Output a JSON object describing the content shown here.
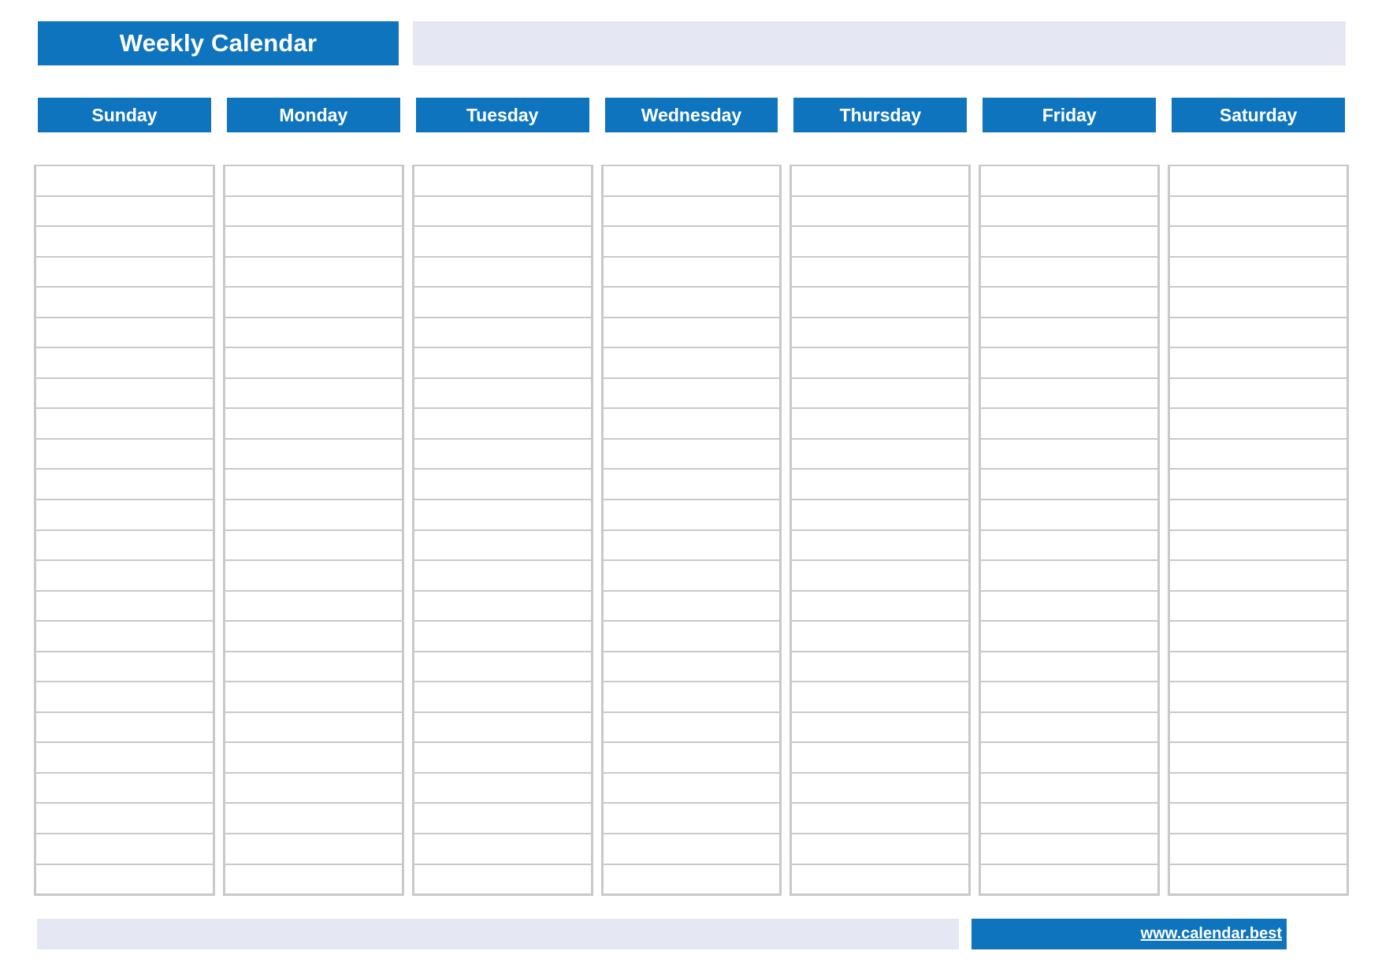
{
  "header": {
    "title": "Weekly Calendar"
  },
  "days": [
    {
      "label": "Sunday"
    },
    {
      "label": "Monday"
    },
    {
      "label": "Tuesday"
    },
    {
      "label": "Wednesday"
    },
    {
      "label": "Thursday"
    },
    {
      "label": "Friday"
    },
    {
      "label": "Saturday"
    }
  ],
  "grid": {
    "rows_per_day": 24,
    "cell_value": ""
  },
  "footer": {
    "link_text": "www.calendar.best"
  },
  "colors": {
    "brand_blue": "#0f74be",
    "pale_blue": "#e5e8f2",
    "grid_line": "#c9c9c9",
    "header_text": "#ffffff",
    "page_background": "#ffffff"
  }
}
